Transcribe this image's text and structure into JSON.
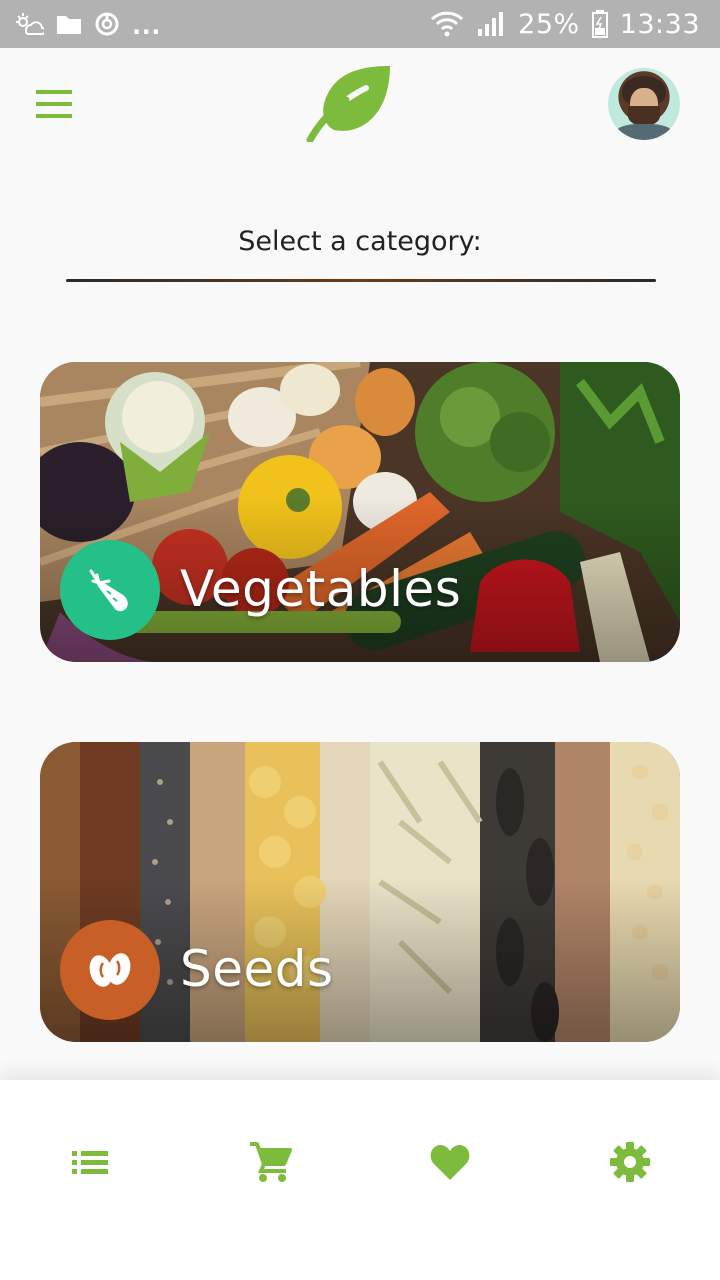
{
  "status_bar": {
    "overflow_dots": "...",
    "battery_percent": "25%",
    "time": "13:33",
    "icons": [
      "cloud-sun-icon",
      "folder-icon",
      "sync-icon",
      "wifi-icon",
      "signal-icon",
      "battery-icon"
    ]
  },
  "app_bar": {
    "menu_icon": "hamburger-menu-icon",
    "logo_icon": "leaf-icon",
    "avatar_icon": "user-avatar"
  },
  "main": {
    "heading": "Select a category:",
    "categories": [
      {
        "label": "Vegetables",
        "icon": "carrot-icon",
        "badge_color": "#25c087"
      },
      {
        "label": "Seeds",
        "icon": "beans-icon",
        "badge_color": "#c85f27"
      }
    ]
  },
  "bottom_nav": {
    "items": [
      {
        "icon": "list-icon"
      },
      {
        "icon": "cart-icon"
      },
      {
        "icon": "heart-icon"
      },
      {
        "icon": "gear-icon"
      }
    ],
    "accent_color": "#7dbb3c"
  },
  "colors": {
    "accent": "#7dbb3c",
    "status_bar": "#b2b2b2",
    "background": "#f9f9f9"
  }
}
